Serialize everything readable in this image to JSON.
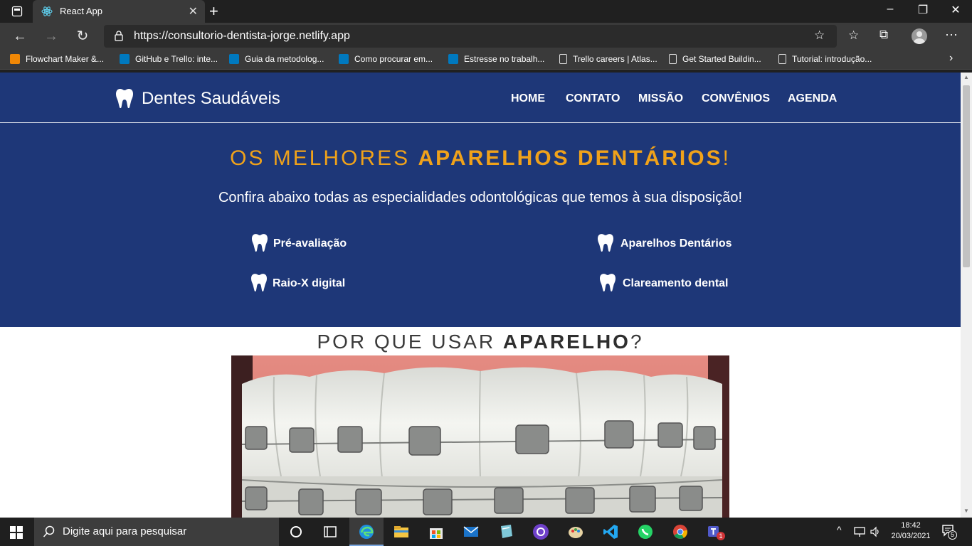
{
  "browser": {
    "tab_title": "React App",
    "url": "https://consultorio-dentista-jorge.netlify.app",
    "bookmarks": [
      {
        "label": "Flowchart Maker &...",
        "icon": "drawio-icon"
      },
      {
        "label": "GitHub e Trello: inte...",
        "icon": "trello-icon"
      },
      {
        "label": "Guia da metodolog...",
        "icon": "trello-icon"
      },
      {
        "label": "Como procurar em...",
        "icon": "trello-icon"
      },
      {
        "label": "Estresse no trabalh...",
        "icon": "trello-icon"
      },
      {
        "label": "Trello careers | Atlas...",
        "icon": "page-icon"
      },
      {
        "label": "Get Started Buildin...",
        "icon": "page-icon"
      },
      {
        "label": "Tutorial: introdução...",
        "icon": "page-icon"
      }
    ]
  },
  "site": {
    "brand": "Dentes Saudáveis",
    "nav": [
      "HOME",
      "CONTATO",
      "MISSÃO",
      "CONVÊNIOS",
      "AGENDA"
    ],
    "headline_light": "OS MELHORES ",
    "headline_bold": "APARELHOS DENTÁRIOS",
    "headline_end": "!",
    "subtitle": "Confira abaixo todas as especialidades odontológicas que temos à sua disposição!",
    "specialties": [
      "Pré-avaliação",
      "Aparelhos Dentários",
      "Raio-X digital",
      "Clareamento dental"
    ],
    "why_light": "POR QUE USAR ",
    "why_bold": "APARELHO",
    "why_end": "?"
  },
  "taskbar": {
    "search_placeholder": "Digite aqui para pesquisar",
    "time": "18:42",
    "date": "20/03/2021",
    "notifications": "5",
    "teams_badge": "1"
  },
  "colors": {
    "hero_bg": "#1e3778",
    "accent": "#f0a21a"
  }
}
